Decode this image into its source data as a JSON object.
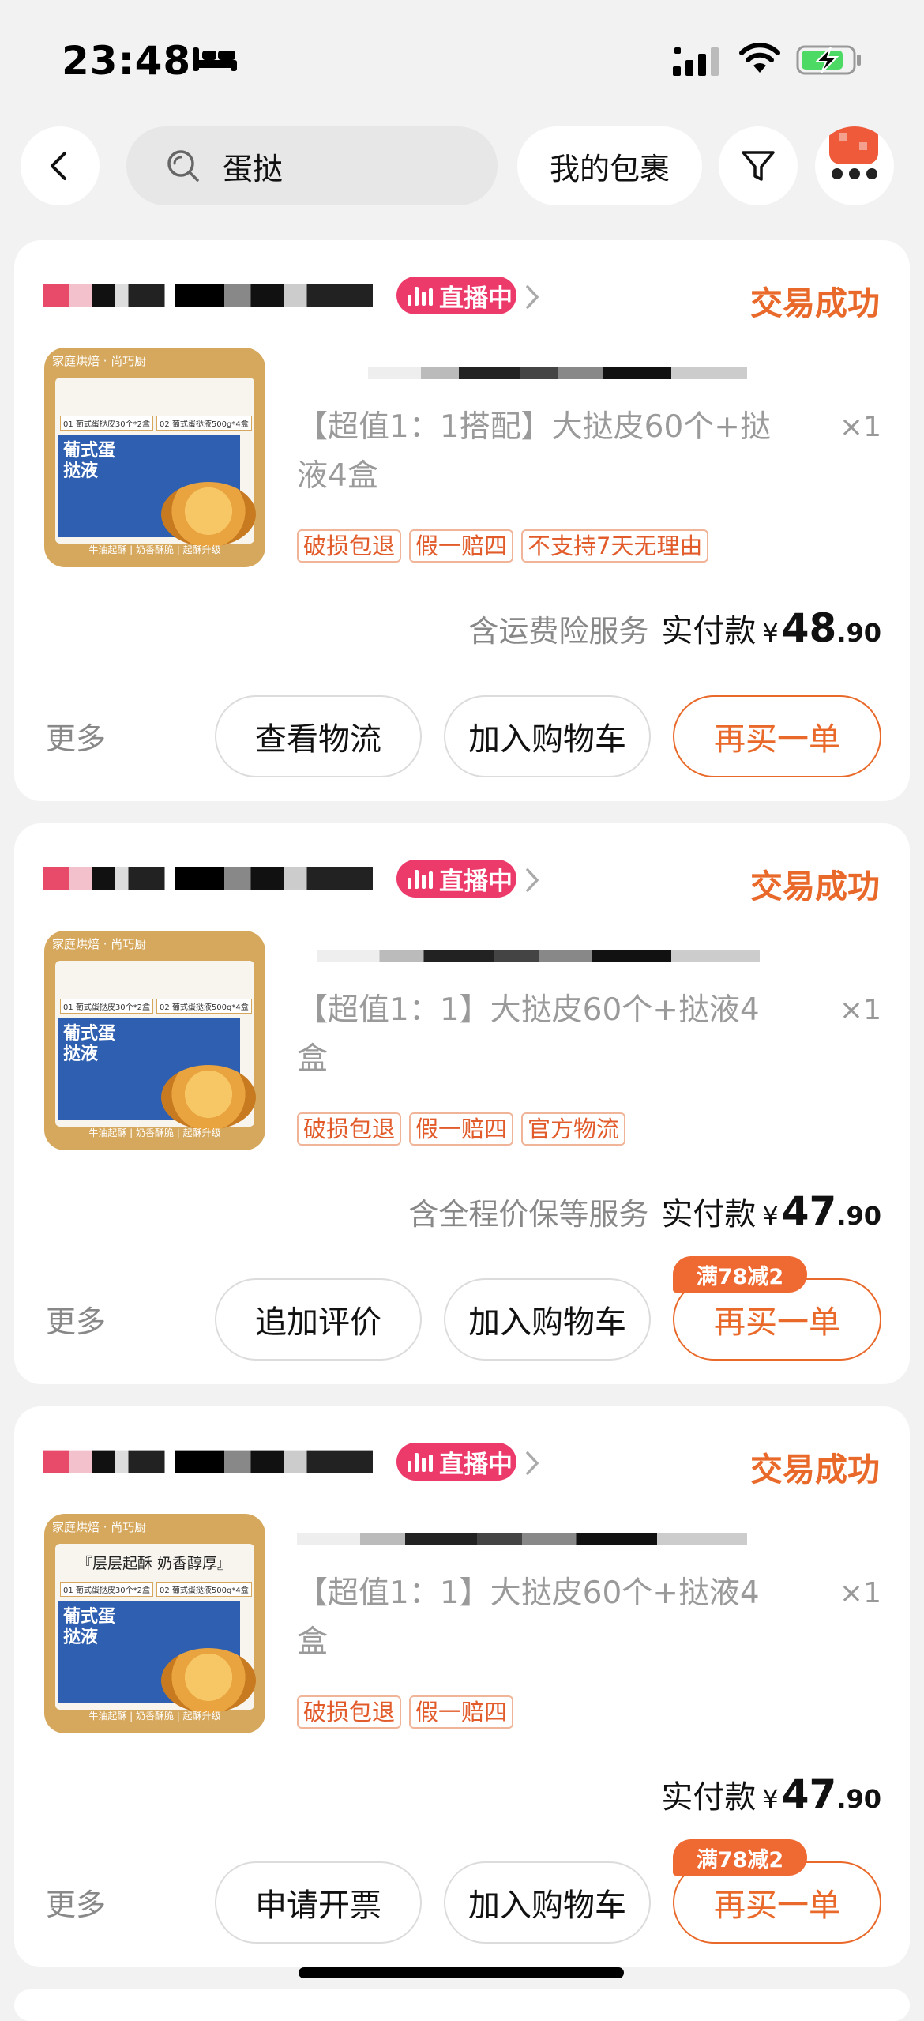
{
  "status_bar": {
    "time": "23:48"
  },
  "search": {
    "query": "蛋挞"
  },
  "nav": {
    "package_label": "我的包裹"
  },
  "thumb": {
    "brand": "家庭烘焙 · 尚巧厨",
    "tag1": "01 葡式蛋挞皮30个*2盒",
    "tag2": "02 葡式蛋挞液500g*4盒",
    "box_text": "葡式蛋挞液",
    "footer": "牛油起酥 | 奶香酥脆 | 起酥升级",
    "slogan": "『层层起酥 奶香醇厚』"
  },
  "orders": [
    {
      "live_label": "直播中",
      "status": "交易成功",
      "title": "【超值1：1搭配】大挞皮60个+挞液4盒",
      "qty": "×1",
      "tags": [
        "破损包退",
        "假一赔四",
        "不支持7天无理由"
      ],
      "service": "含运费险服务",
      "pay_label": "实付款",
      "pay_yen": "¥",
      "pay_int": "48",
      "pay_dec": ".90",
      "more": "更多",
      "btn1": "查看物流",
      "btn2": "加入购物车",
      "btn3": "再买一单",
      "promo": ""
    },
    {
      "live_label": "直播中",
      "status": "交易成功",
      "title": "【超值1：1】大挞皮60个+挞液4盒",
      "qty": "×1",
      "tags": [
        "破损包退",
        "假一赔四",
        "官方物流"
      ],
      "service": "含全程价保等服务",
      "pay_label": "实付款",
      "pay_yen": "¥",
      "pay_int": "47",
      "pay_dec": ".90",
      "more": "更多",
      "btn1": "追加评价",
      "btn2": "加入购物车",
      "btn3": "再买一单",
      "promo": "满78减2"
    },
    {
      "live_label": "直播中",
      "status": "交易成功",
      "title": "【超值1：1】大挞皮60个+挞液4盒",
      "qty": "×1",
      "tags": [
        "破损包退",
        "假一赔四"
      ],
      "service": "",
      "pay_label": "实付款",
      "pay_yen": "¥",
      "pay_int": "47",
      "pay_dec": ".90",
      "more": "更多",
      "btn1": "申请开票",
      "btn2": "加入购物车",
      "btn3": "再买一单",
      "promo": "满78减2"
    }
  ],
  "colors": {
    "accent": "#e9692a",
    "live": "#ec3a6b",
    "tag": "#e25b2a"
  }
}
